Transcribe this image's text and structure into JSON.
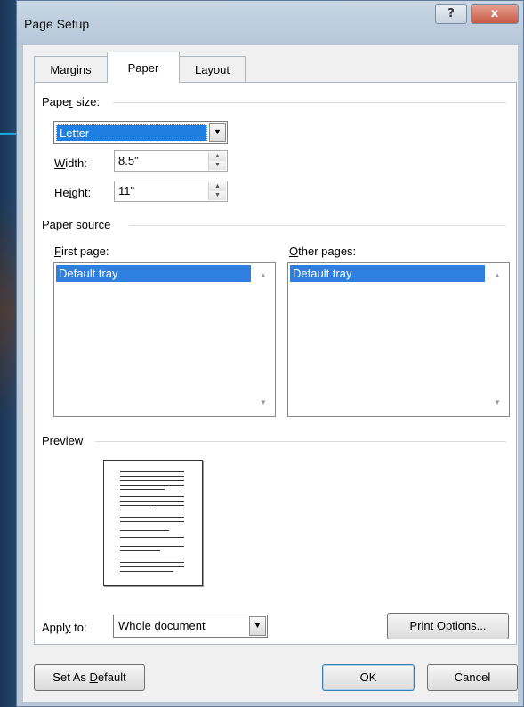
{
  "window": {
    "title": "Page Setup",
    "help_label": "?",
    "close_label": "x"
  },
  "tabs": [
    {
      "label": "Margins",
      "active": false
    },
    {
      "label": "Paper",
      "active": true
    },
    {
      "label": "Layout",
      "active": false
    }
  ],
  "paper_size": {
    "group_label_pre": "Pape",
    "group_label_key": "r",
    "group_label_post": " size:",
    "selected": "Letter",
    "width_label_key": "W",
    "width_label_rest": "idth:",
    "width_value": "8.5\"",
    "height_label_pre": "He",
    "height_label_key": "i",
    "height_label_post": "ght:",
    "height_value": "11\""
  },
  "paper_source": {
    "group_label": "Paper source",
    "first_page_key": "F",
    "first_page_rest": "irst page:",
    "first_page_selected": "Default tray",
    "other_pages_key": "O",
    "other_pages_rest": "ther pages:",
    "other_pages_selected": "Default tray"
  },
  "preview": {
    "group_label": "Preview"
  },
  "apply_to": {
    "label_pre": "Appl",
    "label_key": "y",
    "label_post": " to:",
    "value": "Whole document"
  },
  "buttons": {
    "print_options_pre": "Print Op",
    "print_options_key": "t",
    "print_options_post": "ions...",
    "set_default_pre": "Set As ",
    "set_default_key": "D",
    "set_default_post": "efault",
    "ok": "OK",
    "cancel": "Cancel"
  },
  "icons": {
    "dropdown": "chevron-down-icon",
    "spin_up": "spin-up-icon",
    "spin_down": "spin-down-icon",
    "scroll_up": "scroll-up-icon",
    "scroll_down": "scroll-down-icon"
  },
  "colors": {
    "selection": "#1e7fe0",
    "pointer": "#1aa0dd",
    "desktop": "#1f3f63"
  }
}
